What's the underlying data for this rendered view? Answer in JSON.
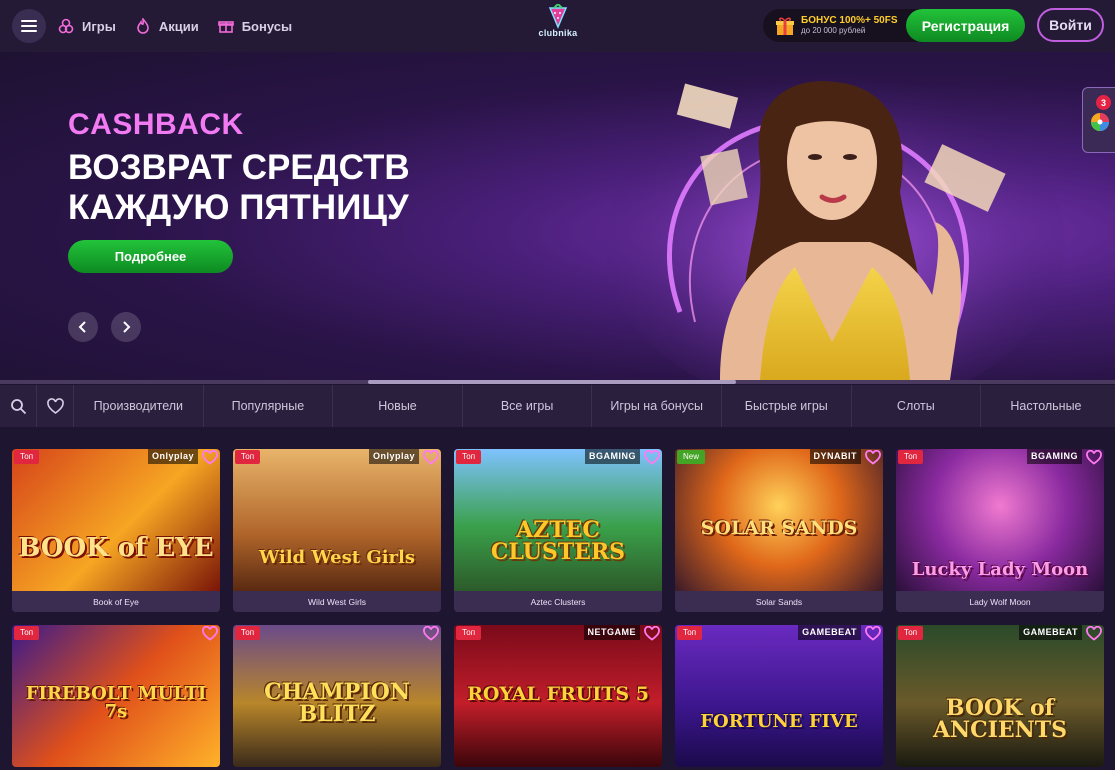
{
  "header": {
    "nav": [
      {
        "label": "Игры",
        "icon": "slots-cherry-icon"
      },
      {
        "label": "Акции",
        "icon": "flame-icon"
      },
      {
        "label": "Бонусы",
        "icon": "gift-icon"
      }
    ],
    "logo_text": "clubnika",
    "bonus_title": "БОНУС 100%+ 50FS",
    "bonus_subtitle": "до 20 000 рублей",
    "register_label": "Регистрация",
    "login_label": "Войти"
  },
  "banner": {
    "eyebrow": "CASHBACK",
    "title_line1": "ВОЗВРАТ СРЕДСТВ",
    "title_line2": "КАЖДУЮ ПЯТНИЦУ",
    "cta_label": "Подробнее",
    "slider_progress": 0.33
  },
  "side_widget": {
    "badge_count": "3",
    "icon": "fortune-wheel-icon"
  },
  "categories": [
    "Производители",
    "Популярные",
    "Новые",
    "Все игры",
    "Игры на бонусы",
    "Быстрые игры",
    "Слоты",
    "Настольные"
  ],
  "games": [
    {
      "name": "Book of Eye",
      "art": "BOOK of EYE",
      "badge": "Топ",
      "provider": "Onlyplay"
    },
    {
      "name": "Wild West Girls",
      "art": "Wild West Girls",
      "badge": "Топ",
      "provider": "Onlyplay"
    },
    {
      "name": "Aztec Clusters",
      "art": "AZTEC CLUSTERS",
      "badge": "Топ",
      "provider": "BGAMING"
    },
    {
      "name": "Solar Sands",
      "art": "SOLAR SANDS",
      "badge": "New",
      "provider": "DYNABIT"
    },
    {
      "name": "Lady Wolf Moon",
      "art": "Lucky Lady Moon",
      "badge": "Топ",
      "provider": "BGAMING"
    },
    {
      "name": "Firebolt Multi 7s",
      "art": "FIREBOLT MULTI 7s",
      "badge": "Топ",
      "provider": ""
    },
    {
      "name": "Champion Blitz",
      "art": "CHAMPION BLITZ",
      "badge": "Топ",
      "provider": ""
    },
    {
      "name": "Royal Fruits",
      "art": "ROYAL FRUITS 5",
      "badge": "Топ",
      "provider": "NETGAME"
    },
    {
      "name": "Fortune Five Double",
      "art": "FORTUNE FIVE",
      "badge": "Топ",
      "provider": "GAMEBEAT"
    },
    {
      "name": "Book of Ancients",
      "art": "BOOK of ANCIENTS",
      "badge": "Топ",
      "provider": "GAMEBEAT"
    }
  ],
  "colors": {
    "accent_green": "#22c33a",
    "accent_pink": "#f27bf4",
    "badge_top": "#e0273f",
    "badge_new": "#43a425"
  }
}
